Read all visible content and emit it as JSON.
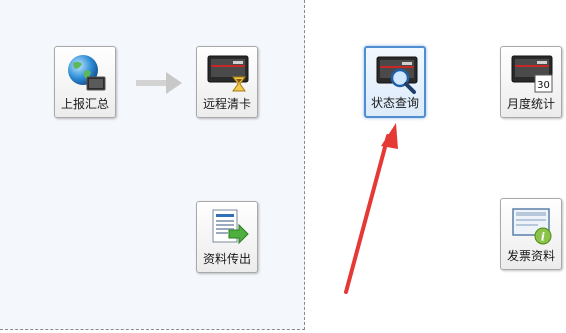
{
  "tiles": {
    "report": {
      "label": "上报汇总"
    },
    "remote_clear": {
      "label": "远程清卡"
    },
    "status_query": {
      "label": "状态查询"
    },
    "monthly_stats": {
      "label": "月度统计",
      "calendar_day": "30"
    },
    "data_export": {
      "label": "资料传出"
    },
    "invoice_data": {
      "label": "发票资料"
    }
  },
  "colors": {
    "accent": "#4f8fd0",
    "annotation_arrow": "#e53935",
    "flow_arrow": "#cfcfcf",
    "panel_bg": "#f4f7fc"
  }
}
